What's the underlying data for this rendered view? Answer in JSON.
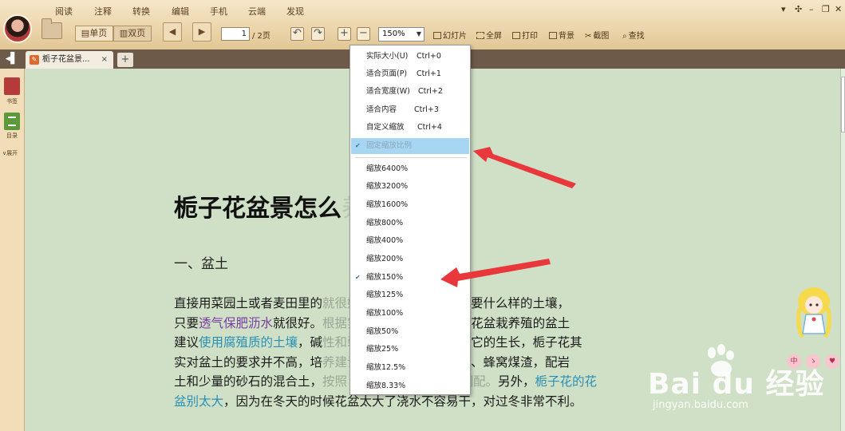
{
  "menu": [
    "阅读",
    "注释",
    "转换",
    "编辑",
    "手机",
    "云端",
    "发现"
  ],
  "toolbar": {
    "single_page": "单页",
    "double_page": "双页",
    "page_current": "1",
    "page_total": "/ 2页",
    "zoom_value": "150%",
    "tools": [
      "幻灯片",
      "全屏",
      "打印",
      "背景",
      "截图",
      "查找"
    ]
  },
  "tab": {
    "title": "栀子花盆景...",
    "close": "×",
    "new": "+"
  },
  "sidebar": {
    "bookmark_label": "书签",
    "toc_label": "目录",
    "expand_label": "展开"
  },
  "zoom_menu": {
    "items": [
      {
        "label": "实际大小(U)",
        "shortcut": "Ctrl+0"
      },
      {
        "label": "适合页面(P)",
        "shortcut": "Ctrl+1"
      },
      {
        "label": "适合宽度(W)",
        "shortcut": "Ctrl+2"
      },
      {
        "label": "适合内容",
        "shortcut": "Ctrl+3"
      },
      {
        "label": "自定义缩放",
        "shortcut": "Ctrl+4"
      },
      {
        "label": "固定缩放比例",
        "shortcut": ""
      }
    ],
    "levels": [
      "缩放6400%",
      "缩放3200%",
      "缩放1600%",
      "缩放800%",
      "缩放400%",
      "缩放200%",
      "缩放150%",
      "缩放125%",
      "缩放100%",
      "缩放50%",
      "缩放25%",
      "缩放12.5%",
      "缩放8.33%"
    ],
    "checked_level": "缩放150%"
  },
  "document": {
    "title_visible": "栀子花盆景怎么",
    "title_faint": "养护",
    "heading": "一、盆土",
    "para": {
      "l1a": "直接用菜园土或者麦田里的",
      "l1b": "就很好，没",
      "l1c": "必要非得一定需要什么样的土壤，",
      "l2a": "只要",
      "l2link": "透气保肥沥水",
      "l2b": "就很好。",
      "l2c": "根据实际情况就可以。",
      "l2d": "栀子花盆栽养殖的盆土",
      "l3a": "建议",
      "l3link": "使用腐殖质的土壤",
      "l3b": "，碱",
      "l3c": "性和弱碱性的",
      "l3d": "土壤都不利于它的生长，栀子花其",
      "l4a": "实对盆土的要求并不高，培",
      "l4c": "养建议使用：",
      "l4d": "腐叶土、园土、蜂窝煤渣，配岩",
      "l5a": "土和少量的砂石的混合土，",
      "l5b": "按照 3:2:1:1 的比例混合调配。",
      "l5c": "另外，",
      "l5link": "栀子花的花",
      "l6link": "盆别太大",
      "l6b": "，因为在冬天的时候花盆太大了浇水不容易干，对过冬非常不利。"
    }
  },
  "watermark": {
    "brand": "Bai du 经验",
    "url": "jingyan.baidu.com"
  },
  "mascot_badges": [
    "中",
    "ゝ",
    "♥"
  ],
  "colors": {
    "toolbar_wood": "#ecd6ad",
    "tabstrip": "#6d5a49",
    "page_bg": "#cfe0c6",
    "link_blue": "#2a8fb4",
    "link_purple": "#7a3ca0",
    "menu_highlight": "#a7d6f3",
    "arrow_red": "#e8383b"
  }
}
